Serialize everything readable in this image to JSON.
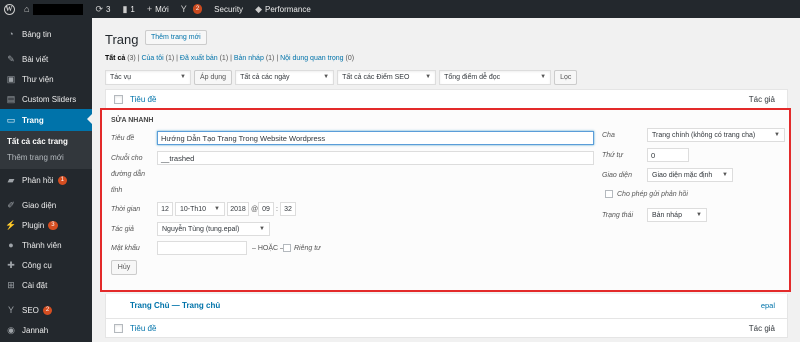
{
  "adminbar": {
    "updates_count": "3",
    "comments_count": "1",
    "new_label": "Mới",
    "yoast_badge": "2",
    "security_label": "Security",
    "performance_label": "Performance"
  },
  "sidebar": {
    "items": [
      {
        "label": "Bảng tin",
        "icon": "dashboard-icon"
      },
      {
        "label": "Bài viết",
        "icon": "pin-icon"
      },
      {
        "label": "Thư viện",
        "icon": "media-icon"
      },
      {
        "label": "Custom Sliders",
        "icon": "slides-icon"
      },
      {
        "label": "Trang",
        "icon": "page-icon"
      },
      {
        "label": "Phản hồi",
        "icon": "comment-icon",
        "badge": "1"
      },
      {
        "label": "Giao diện",
        "icon": "brush-icon"
      },
      {
        "label": "Plugin",
        "icon": "plugin-icon",
        "badge": "3"
      },
      {
        "label": "Thành viên",
        "icon": "users-icon"
      },
      {
        "label": "Công cụ",
        "icon": "tools-icon"
      },
      {
        "label": "Cài đặt",
        "icon": "settings-icon"
      },
      {
        "label": "SEO",
        "icon": "seo-icon",
        "badge": "2"
      },
      {
        "label": "Jannah",
        "icon": "theme-icon"
      }
    ],
    "submenu": [
      "Tất cả các trang",
      "Thêm trang mới"
    ]
  },
  "header": {
    "title": "Trang",
    "add_new": "Thêm trang mới"
  },
  "filters": {
    "all": "Tất cả",
    "all_count": "(3)",
    "mine": "Của tôi",
    "mine_count": "(1)",
    "published": "Đã xuất bản",
    "published_count": "(1)",
    "drafts": "Bản nháp",
    "drafts_count": "(1)",
    "cornerstone": "Nội dung quan trọng",
    "cornerstone_count": "(0)"
  },
  "tablenav": {
    "bulk_action": "Tác vụ",
    "apply": "Áp dụng",
    "dates": "Tất cả các ngày",
    "seo_scores": "Tất cả các Điểm SEO",
    "readability": "Tổng điểm dễ đọc",
    "filter": "Lọc"
  },
  "table": {
    "col_title": "Tiêu đề",
    "col_author": "Tác giả"
  },
  "quick_edit": {
    "legend": "SỬA NHANH",
    "title_label": "Tiêu đề",
    "title_value": "Hướng Dẫn Tạo Trang Trong Website Wordpress",
    "slug_label_1": "Chuỗi cho",
    "slug_label_2": "đường dẫn",
    "slug_label_3": "tĩnh",
    "slug_value": "__trashed",
    "date_label": "Thời gian",
    "date_day": "12",
    "date_month": "10-Th10",
    "date_year": "2018",
    "date_at": "@",
    "date_hour": "09",
    "date_sep": ":",
    "date_min": "32",
    "author_label": "Tác giả",
    "author_value": "Nguyễn Tùng (tung.epal)",
    "password_label": "Mật khẩu",
    "or_label": "– HOẶC –",
    "private_label": "Riêng tư",
    "parent_label": "Cha",
    "parent_value": "Trang chính (không có trang cha)",
    "order_label": "Thứ tự",
    "order_value": "0",
    "template_label": "Giao diện",
    "template_value": "Giao diện mặc định",
    "comments_label": "Cho phép gửi phản hồi",
    "status_label": "Trạng thái",
    "status_value": "Bản nháp",
    "cancel": "Hủy"
  },
  "rows": [
    {
      "title": "Trang Chủ — Trang chủ",
      "author": "epal"
    }
  ]
}
